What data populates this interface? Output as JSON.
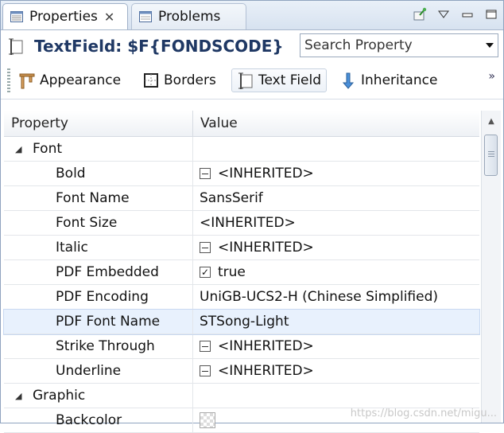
{
  "tabs": [
    {
      "label": "Properties",
      "icon": "properties-icon",
      "active": true
    },
    {
      "label": "Problems",
      "icon": "problems-icon",
      "active": false
    }
  ],
  "close_glyph": "✕",
  "title": "TextField: $F{FONDSCODE}",
  "search": {
    "value": "Search Property"
  },
  "categories": [
    {
      "label": "Appearance",
      "icon": "appearance-icon"
    },
    {
      "label": "Borders",
      "icon": "borders-icon"
    },
    {
      "label": "Text Field",
      "icon": "text-field-icon",
      "active": true
    },
    {
      "label": "Inheritance",
      "icon": "inheritance-icon"
    }
  ],
  "more_glyph": "»",
  "table": {
    "headers": [
      "Property",
      "Value"
    ],
    "rows": [
      {
        "type": "category",
        "label": "Font"
      },
      {
        "type": "prop",
        "label": "Bold",
        "value": "<INHERITED>",
        "check": "mixed"
      },
      {
        "type": "prop",
        "label": "Font Name",
        "value": "SansSerif"
      },
      {
        "type": "prop",
        "label": "Font Size",
        "value": "<INHERITED>"
      },
      {
        "type": "prop",
        "label": "Italic",
        "value": "<INHERITED>",
        "check": "mixed"
      },
      {
        "type": "prop",
        "label": "PDF Embedded",
        "value": "true",
        "check": "checked"
      },
      {
        "type": "prop",
        "label": "PDF Encoding",
        "value": "UniGB-UCS2-H (Chinese Simplified)"
      },
      {
        "type": "prop",
        "label": "PDF Font Name",
        "value": "STSong-Light",
        "selected": true
      },
      {
        "type": "prop",
        "label": "Strike Through",
        "value": "<INHERITED>",
        "check": "mixed"
      },
      {
        "type": "prop",
        "label": "Underline",
        "value": "<INHERITED>",
        "check": "mixed"
      },
      {
        "type": "category",
        "label": "Graphic"
      },
      {
        "type": "prop",
        "label": "Backcolor",
        "value": "",
        "swatch": true
      }
    ]
  },
  "watermark": "https://blog.csdn.net/migu..."
}
